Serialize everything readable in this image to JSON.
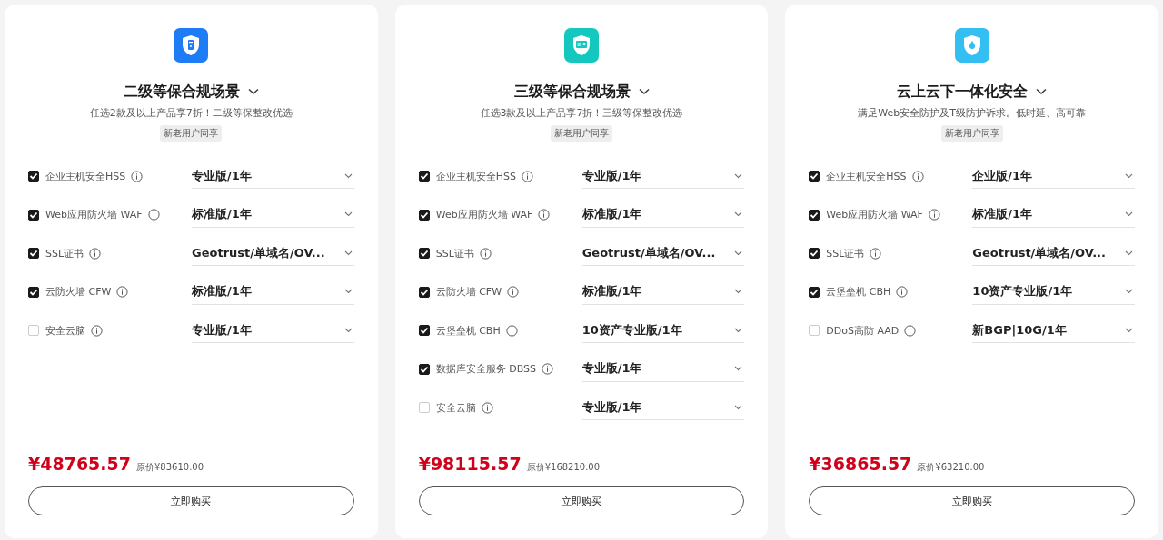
{
  "cards": [
    {
      "icon": {
        "kind": "server",
        "color": "#1f7cf7"
      },
      "title": "二级等保合规场景",
      "subtitle": "任选2款及以上产品享7折！二级等保整改优选",
      "tag": "新老用户同享",
      "items": [
        {
          "label": "企业主机安全HSS",
          "checked": true,
          "value": "专业版/1年"
        },
        {
          "label": "Web应用防火墙 WAF",
          "checked": true,
          "value": "标准版/1年"
        },
        {
          "label": "SSL证书",
          "checked": true,
          "value": "Geotrust/单域名/OV..."
        },
        {
          "label": "云防火墙 CFW",
          "checked": true,
          "value": "标准版/1年"
        },
        {
          "label": "安全云脑",
          "checked": false,
          "value": "专业版/1年"
        }
      ],
      "price": "¥48765.57",
      "original_price": "原价¥83610.00",
      "button": "立即购买"
    },
    {
      "icon": {
        "kind": "card",
        "color": "#14c8c0"
      },
      "title": "三级等保合规场景",
      "subtitle": "任选3款及以上产品享7折！三级等保整改优选",
      "tag": "新老用户同享",
      "items": [
        {
          "label": "企业主机安全HSS",
          "checked": true,
          "value": "专业版/1年"
        },
        {
          "label": "Web应用防火墙 WAF",
          "checked": true,
          "value": "标准版/1年"
        },
        {
          "label": "SSL证书",
          "checked": true,
          "value": "Geotrust/单域名/OV..."
        },
        {
          "label": "云防火墙 CFW",
          "checked": true,
          "value": "标准版/1年"
        },
        {
          "label": "云堡垒机 CBH",
          "checked": true,
          "value": "10资产专业版/1年"
        },
        {
          "label": "数据库安全服务 DBSS",
          "checked": true,
          "value": "专业版/1年"
        },
        {
          "label": "安全云脑",
          "checked": false,
          "value": "专业版/1年"
        }
      ],
      "price": "¥98115.57",
      "original_price": "原价¥168210.00",
      "button": "立即购买"
    },
    {
      "icon": {
        "kind": "drop",
        "color": "#34bff3"
      },
      "title": "云上云下一体化安全",
      "subtitle": "满足Web安全防护及T级防护诉求。低时延、高可靠",
      "tag": "新老用户同享",
      "items": [
        {
          "label": "企业主机安全HSS",
          "checked": true,
          "value": "企业版/1年"
        },
        {
          "label": "Web应用防火墙 WAF",
          "checked": true,
          "value": "标准版/1年"
        },
        {
          "label": "SSL证书",
          "checked": true,
          "value": "Geotrust/单域名/OV..."
        },
        {
          "label": "云堡垒机 CBH",
          "checked": true,
          "value": "10资产专业版/1年"
        },
        {
          "label": "DDoS高防 AAD",
          "checked": false,
          "value": "新BGP|10G/1年"
        }
      ],
      "price": "¥36865.57",
      "original_price": "原价¥63210.00",
      "button": "立即购买"
    }
  ]
}
